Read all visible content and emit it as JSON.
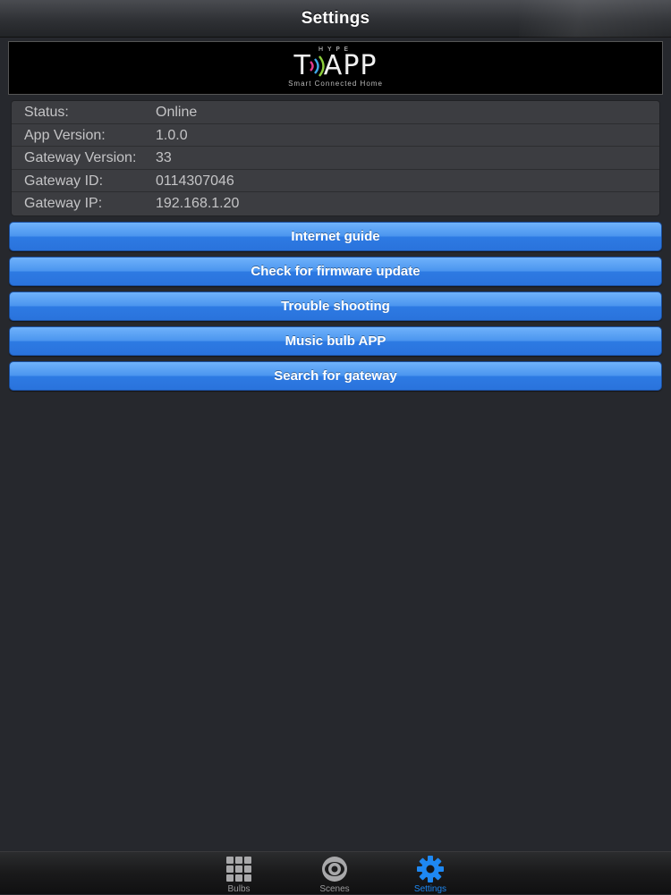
{
  "navbar": {
    "title": "Settings"
  },
  "banner": {
    "hype": "HYPE",
    "wordmark_left": "T",
    "wordmark_right": "APP",
    "tagline": "Smart Connected Home"
  },
  "info": {
    "rows": [
      {
        "label": "Status:",
        "value": "Online"
      },
      {
        "label": "App Version:",
        "value": "1.0.0"
      },
      {
        "label": "Gateway Version:",
        "value": "33"
      },
      {
        "label": "Gateway ID:",
        "value": "0114307046"
      },
      {
        "label": "Gateway IP:",
        "value": "192.168.1.20"
      }
    ]
  },
  "buttons": {
    "internet_guide": "Internet guide",
    "firmware_update": "Check for firmware update",
    "trouble_shooting": "Trouble shooting",
    "music_bulb": "Music bulb APP",
    "search_gateway": "Search for gateway"
  },
  "tabbar": {
    "tabs": [
      {
        "label": "Bulbs",
        "icon": "grid-icon"
      },
      {
        "label": "Scenes",
        "icon": "scenes-eye-icon"
      },
      {
        "label": "Settings",
        "icon": "gear-icon"
      }
    ],
    "active": "Settings"
  },
  "colors": {
    "accent": "#1e88f2",
    "button_blue": "#4b95ef",
    "background": "#26282d"
  }
}
